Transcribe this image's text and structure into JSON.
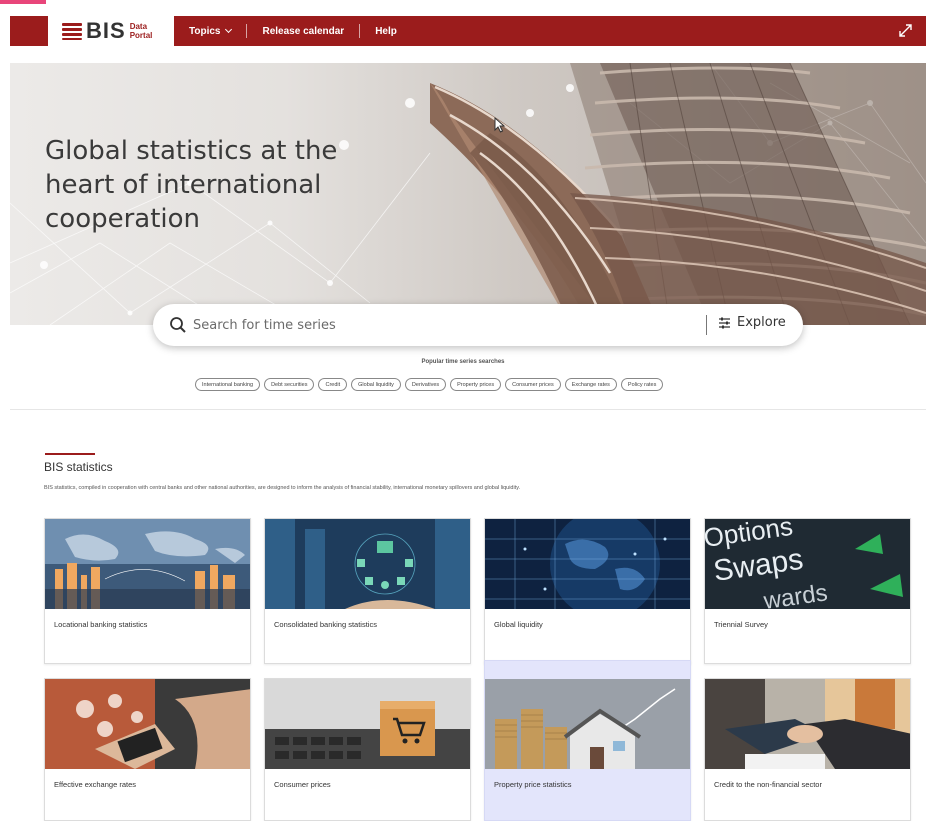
{
  "nav": {
    "logo_text": "BIS",
    "logo_sub_1": "Data",
    "logo_sub_2": "Portal",
    "items": [
      {
        "label": "Topics"
      },
      {
        "label": "Release calendar"
      },
      {
        "label": "Help"
      }
    ]
  },
  "hero": {
    "title": "Global statistics at the heart of international cooperation"
  },
  "search": {
    "placeholder": "Search for time series",
    "explore_label": "Explore",
    "popular_label": "Popular time series searches",
    "chips": [
      "International banking",
      "Debt securities",
      "Credit",
      "Global liquidity",
      "Derivatives",
      "Property prices",
      "Consumer prices",
      "Exchange rates",
      "Policy rates"
    ]
  },
  "section": {
    "title": "BIS statistics",
    "description": "BIS statistics, compiled in cooperation with central banks and other national authorities, are designed to inform the analysis of financial stability, international monetary spillovers and global liquidity."
  },
  "cards": [
    {
      "label": "Locational banking statistics"
    },
    {
      "label": "Consolidated banking statistics"
    },
    {
      "label": "Global liquidity"
    },
    {
      "label": "Triennial Survey"
    },
    {
      "label": "Effective exchange rates"
    },
    {
      "label": "Consumer prices"
    },
    {
      "label": "Property price statistics"
    },
    {
      "label": "Credit to the non-financial sector"
    }
  ],
  "card_image_text": {
    "triennial_1": "Options",
    "triennial_2": "Swaps",
    "triennial_3": "wards"
  },
  "colors": {
    "brand": "#9b1c1c",
    "highlight": "#e3e5fb"
  }
}
